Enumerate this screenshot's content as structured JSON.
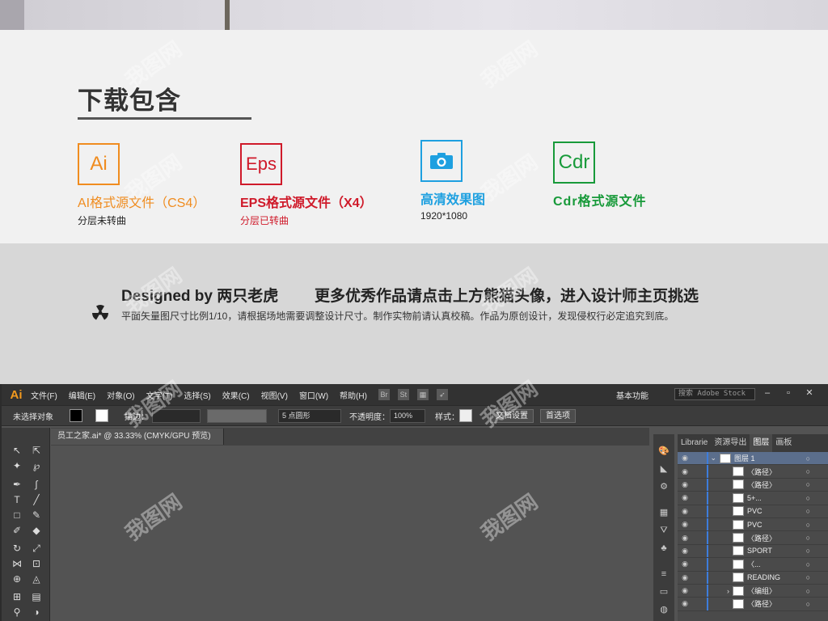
{
  "download": {
    "title": "下载包含",
    "formats": [
      {
        "badge": "Ai",
        "name": "AI格式源文件（CS4）",
        "sub": "分层未转曲"
      },
      {
        "badge": "Eps",
        "name": "EPS格式源文件（X4）",
        "sub": "分层已转曲"
      },
      {
        "badge": "",
        "name": "高清效果图",
        "sub": "1920*1080"
      },
      {
        "badge": "Cdr",
        "name": "Cdr格式源文件",
        "sub": ""
      }
    ]
  },
  "designer": {
    "designed_by": "Designed by 两只老虎",
    "promo": "更多优秀作品请点击上方熊猫头像，进入设计师主页挑选",
    "note": "平面矢量图尺寸比例1/10，请根据场地需要调整设计尺寸。制作实物前请认真校稿。作品为原创设计，发现侵权行必定追究到底。"
  },
  "illustrator": {
    "logo": "Ai",
    "menus": [
      "文件(F)",
      "编辑(E)",
      "对象(O)",
      "文字(T)",
      "选择(S)",
      "效果(C)",
      "视图(V)",
      "窗口(W)",
      "帮助(H)"
    ],
    "workspace": "基本功能",
    "search_placeholder": "搜索 Adobe Stock",
    "control": {
      "no_selection": "未选择对象",
      "stroke_label": "描边：",
      "brush": "5 点圆形",
      "opacity_label": "不透明度：",
      "opacity_value": "100%",
      "style_label": "样式：",
      "doc_setup": "文档设置",
      "preferences": "首选项"
    },
    "document_tab": "员工之家.ai* @ 33.33% (CMYK/GPU 预览)",
    "panel_tabs": [
      "Librarie",
      "资源导出",
      "图层",
      "画板"
    ],
    "layers": [
      {
        "name": "图层 1",
        "expand": "⌄"
      },
      {
        "name": "〈路径〉",
        "expand": ""
      },
      {
        "name": "〈路径〉",
        "expand": ""
      },
      {
        "name": "5+...",
        "expand": ""
      },
      {
        "name": "PVC",
        "expand": ""
      },
      {
        "name": "PVC",
        "expand": ""
      },
      {
        "name": "〈路径〉",
        "expand": ""
      },
      {
        "name": "SPORT",
        "expand": ""
      },
      {
        "name": "〈...",
        "expand": ""
      },
      {
        "name": "READING",
        "expand": ""
      },
      {
        "name": "〈编组〉",
        "expand": "›"
      },
      {
        "name": "〈路径〉",
        "expand": ""
      }
    ]
  },
  "watermark": "我图网",
  "colors": {
    "ai": "#f08c1f",
    "eps": "#cf1a2a",
    "hd": "#1ea0e0",
    "cdr": "#189a3a"
  }
}
